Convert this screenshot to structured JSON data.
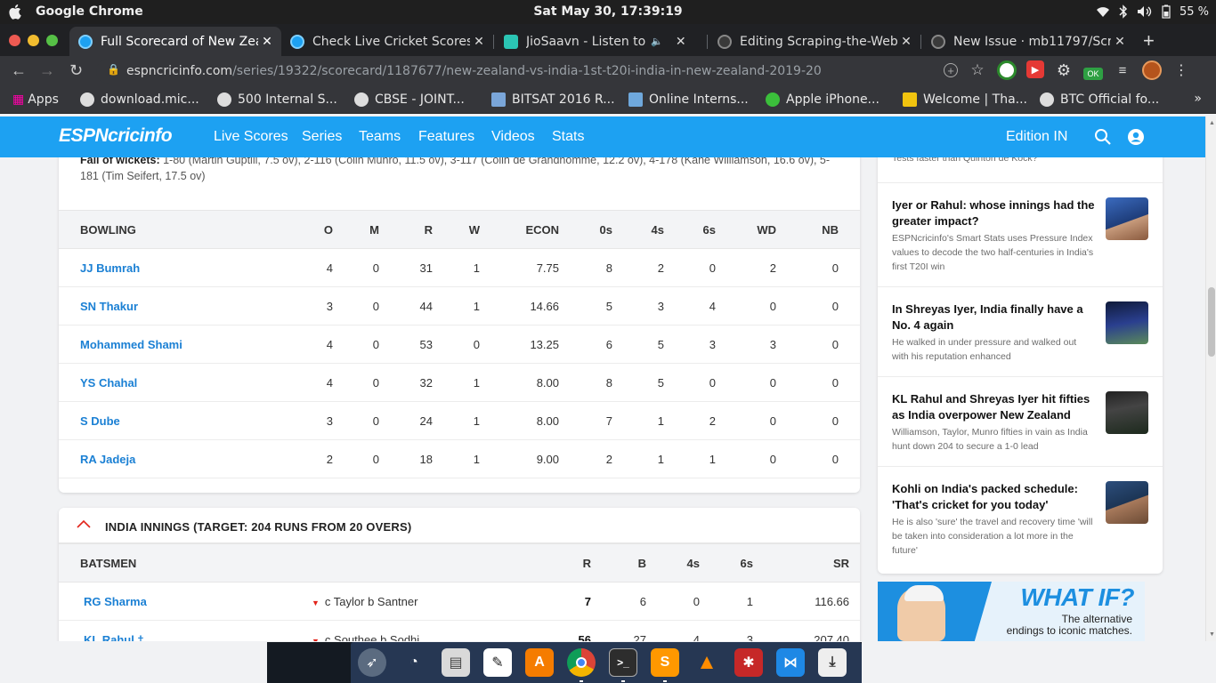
{
  "os": {
    "app_name": "Google Chrome",
    "clock": "Sat May 30, 17:39:19",
    "battery": "55 %"
  },
  "tabs": [
    {
      "title": "Full Scorecard of New Zea",
      "active": true
    },
    {
      "title": "Check Live Cricket Scores,",
      "active": false
    },
    {
      "title": "JioSaavn - Listen to Ne",
      "active": false
    },
    {
      "title": "Editing Scraping-the-Web",
      "active": false
    },
    {
      "title": "New Issue · mb11797/Scra",
      "active": false
    }
  ],
  "omnibox": {
    "url_host": "espncricinfo.com",
    "url_path": "/series/19322/scorecard/1187677/new-zealand-vs-india-1st-t20i-india-in-new-zealand-2019-20"
  },
  "extensions": {
    "ok_badge": "OK"
  },
  "bookmarks": [
    "Apps",
    "download.mic...",
    "500 Internal S...",
    "CBSE - JOINT...",
    "BITSAT 2016 R...",
    "Online Interns...",
    "Apple iPhone...",
    "Welcome | Tha...",
    "BTC Official fo..."
  ],
  "bookmarks_more": "»",
  "site": {
    "logo": "ESPNcricinfo",
    "nav": [
      "Live Scores",
      "Series",
      "Teams",
      "Features",
      "Videos",
      "Stats"
    ],
    "edition": "Edition IN"
  },
  "fall_of_wickets": {
    "label": "Fall of wickets:",
    "text": "1-80 (Martin Guptill, 7.5 ov), 2-116 (Colin Munro, 11.5 ov), 3-117 (Colin de Grandhomme, 12.2 ov), 4-178 (Kane Williamson, 16.6 ov), 5-181 (Tim Seifert, 17.5 ov)"
  },
  "bowling": {
    "headers": [
      "BOWLING",
      "O",
      "M",
      "R",
      "W",
      "ECON",
      "0s",
      "4s",
      "6s",
      "WD",
      "NB"
    ],
    "rows": [
      [
        "JJ Bumrah",
        "4",
        "0",
        "31",
        "1",
        "7.75",
        "8",
        "2",
        "0",
        "2",
        "0"
      ],
      [
        "SN Thakur",
        "3",
        "0",
        "44",
        "1",
        "14.66",
        "5",
        "3",
        "4",
        "0",
        "0"
      ],
      [
        "Mohammed Shami",
        "4",
        "0",
        "53",
        "0",
        "13.25",
        "6",
        "5",
        "3",
        "3",
        "0"
      ],
      [
        "YS Chahal",
        "4",
        "0",
        "32",
        "1",
        "8.00",
        "8",
        "5",
        "0",
        "0",
        "0"
      ],
      [
        "S Dube",
        "3",
        "0",
        "24",
        "1",
        "8.00",
        "7",
        "1",
        "2",
        "0",
        "0"
      ],
      [
        "RA Jadeja",
        "2",
        "0",
        "18",
        "1",
        "9.00",
        "2",
        "1",
        "1",
        "0",
        "0"
      ]
    ]
  },
  "india_innings": {
    "title": "INDIA INNINGS (TARGET: 204 RUNS FROM 20 OVERS)",
    "headers": [
      "BATSMEN",
      "R",
      "B",
      "4s",
      "6s",
      "SR"
    ],
    "rows": [
      {
        "name": "RG Sharma",
        "dismissal": "c Taylor b Santner",
        "r": "7",
        "b": "6",
        "fours": "0",
        "sixes": "1",
        "sr": "116.66"
      },
      {
        "name": "KL Rahul †",
        "dismissal": "c Southee b Sodhi",
        "r": "56",
        "b": "27",
        "fours": "4",
        "sixes": "3",
        "sr": "207.40"
      }
    ]
  },
  "sidebar": {
    "partial_top": "Tests faster than Quinton de Kock?",
    "stories": [
      {
        "headline": "Iyer or Rahul: whose innings had the greater impact?",
        "summary": "ESPNcricinfo's Smart Stats uses Pressure Index values to decode the two half-centuries in India's first T20I win"
      },
      {
        "headline": "In Shreyas Iyer, India finally have a No. 4 again",
        "summary": "He walked in under pressure and walked out with his reputation enhanced"
      },
      {
        "headline": "KL Rahul and Shreyas Iyer hit fifties as India overpower New Zealand",
        "summary": "Williamson, Taylor, Munro fifties in vain as India hunt down 204 to secure a 1-0 lead"
      },
      {
        "headline": "Kohli on India's packed schedule: 'That's cricket for you today'",
        "summary": "He is also 'sure' the travel and recovery time 'will be taken into consideration a lot more in the future'"
      }
    ]
  },
  "ad": {
    "headline": "WHAT IF?",
    "sub1": "The alternative",
    "sub2": "endings to iconic matches."
  },
  "colors": {
    "espn_blue": "#1da1f2",
    "player_link": "#1b80d4",
    "chrome_dark": "#202124"
  }
}
